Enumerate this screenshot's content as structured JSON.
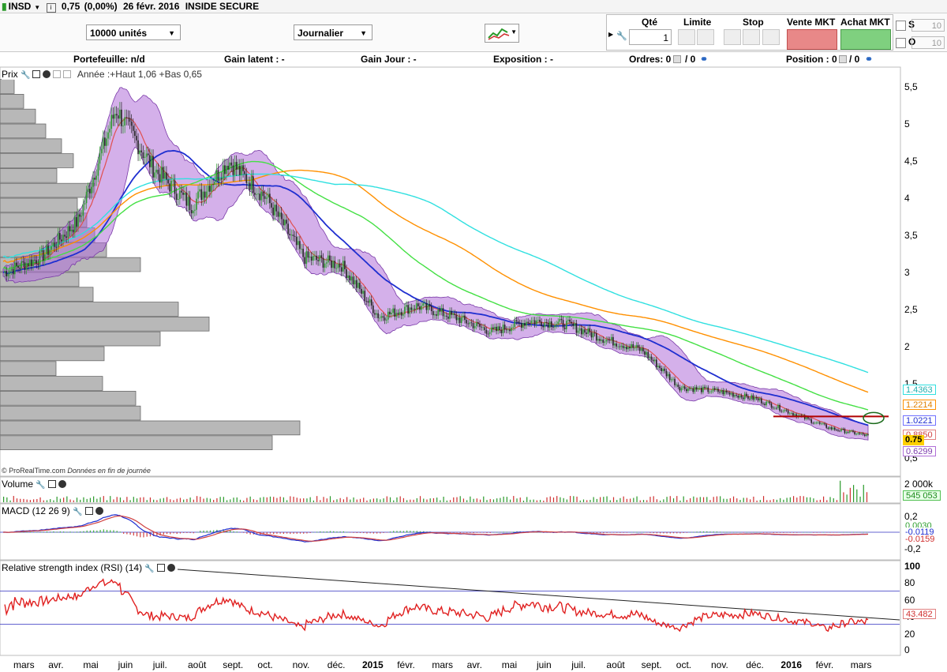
{
  "title_bar": {
    "ticker": "INSD",
    "price": "0,75",
    "change": "(0,00%)",
    "date": "26 févr. 2016",
    "name": "INSIDE SECURE"
  },
  "toolbar": {
    "quantity_select": "10000 unités",
    "period_select": "Journalier",
    "qty_header": "Qté",
    "limit_header": "Limite",
    "stop_header": "Stop",
    "sell_header": "Vente MKT",
    "buy_header": "Achat MKT",
    "qty_value": "1",
    "s_label": "S",
    "o_label": "O",
    "s_value": "10",
    "o_value": "10"
  },
  "status": {
    "portfolio": "Portefeuille: n/d",
    "latent": "Gain latent : -",
    "day": "Gain Jour : -",
    "exposure": "Exposition : -",
    "orders": "Ordres: 0",
    "orders2": "/ 0",
    "position": "Position : 0",
    "position2": "/ 0"
  },
  "price_panel": {
    "label": "Prix",
    "annotation": "Année :+Haut 1,06 +Bas 0,65",
    "source": "© ProRealTime.com",
    "source2": "Données en fin de journée",
    "y_ticks": [
      "5,5",
      "5",
      "4,5",
      "4",
      "3,5",
      "3",
      "2,5",
      "2",
      "1,5",
      "1",
      "0,5"
    ],
    "badges": {
      "cyan": "1.4363",
      "orange": "1.2214",
      "green": "1.0221",
      "red": "0.8850",
      "price": "0.75",
      "purple": "0.6299"
    },
    "colors": {
      "band": "#b06fd8",
      "ma_blue": "#1f2fd0",
      "ma_red": "#e05050",
      "ma_green": "#44e044",
      "ma_orange": "#ff9000",
      "ma_cyan": "#30e0e0",
      "candle_up": "#2a9a2a",
      "candle_down": "#222222",
      "hline": "#b00000"
    }
  },
  "volume_panel": {
    "label": "Volume",
    "y_ticks": [
      "2 000k"
    ],
    "badge": "545 053"
  },
  "macd_panel": {
    "label": "MACD (12 26 9)",
    "y_ticks": [
      "0,2",
      "0",
      "-0,2"
    ],
    "badge1": "0.0030",
    "badge2": "-0.0119",
    "badge3": "-0.0159"
  },
  "rsi_panel": {
    "label": "Relative strength index (RSI) (14)",
    "y_ticks": [
      "100",
      "80",
      "60",
      "40",
      "20",
      "0"
    ],
    "badge": "43.482"
  },
  "x_axis": [
    {
      "label": "mars",
      "bold": false
    },
    {
      "label": "avr.",
      "bold": false
    },
    {
      "label": "mai",
      "bold": false
    },
    {
      "label": "juin",
      "bold": false
    },
    {
      "label": "juil.",
      "bold": false
    },
    {
      "label": "août",
      "bold": false
    },
    {
      "label": "sept.",
      "bold": false
    },
    {
      "label": "oct.",
      "bold": false
    },
    {
      "label": "nov.",
      "bold": false
    },
    {
      "label": "déc.",
      "bold": false
    },
    {
      "label": "2015",
      "bold": true
    },
    {
      "label": "févr.",
      "bold": false
    },
    {
      "label": "mars",
      "bold": false
    },
    {
      "label": "avr.",
      "bold": false
    },
    {
      "label": "mai",
      "bold": false
    },
    {
      "label": "juin",
      "bold": false
    },
    {
      "label": "juil.",
      "bold": false
    },
    {
      "label": "août",
      "bold": false
    },
    {
      "label": "sept.",
      "bold": false
    },
    {
      "label": "oct.",
      "bold": false
    },
    {
      "label": "nov.",
      "bold": false
    },
    {
      "label": "déc.",
      "bold": false
    },
    {
      "label": "2016",
      "bold": true
    },
    {
      "label": "févr.",
      "bold": false
    },
    {
      "label": "mars",
      "bold": false
    }
  ],
  "chart_data": {
    "type": "line",
    "title": "INSD 0,75 (0,00%) 26 févr. 2016 INSIDE SECURE",
    "x": [
      "mars",
      "avr.",
      "mai",
      "juin",
      "juil.",
      "août",
      "sept.",
      "oct.",
      "nov.",
      "déc.",
      "2015",
      "févr.",
      "mars",
      "avr.",
      "mai",
      "juin",
      "juil.",
      "août",
      "sept.",
      "oct.",
      "nov.",
      "déc.",
      "2016",
      "févr."
    ],
    "series": [
      {
        "name": "Prix",
        "values": [
          3.0,
          3.2,
          3.7,
          5.2,
          4.4,
          3.9,
          4.5,
          4.0,
          3.2,
          3.1,
          2.4,
          2.55,
          2.4,
          2.2,
          2.35,
          2.3,
          2.1,
          1.95,
          1.45,
          1.4,
          1.3,
          1.1,
          0.9,
          0.8
        ]
      }
    ],
    "hline": 1.06,
    "volume_by_price": [
      {
        "price": 5.5,
        "volume": 18
      },
      {
        "price": 5.3,
        "volume": 30
      },
      {
        "price": 5.1,
        "volume": 45
      },
      {
        "price": 4.9,
        "volume": 58
      },
      {
        "price": 4.7,
        "volume": 78
      },
      {
        "price": 4.5,
        "volume": 93
      },
      {
        "price": 4.3,
        "volume": 72
      },
      {
        "price": 4.1,
        "volume": 120
      },
      {
        "price": 3.9,
        "volume": 98
      },
      {
        "price": 3.7,
        "volume": 110
      },
      {
        "price": 3.5,
        "volume": 120
      },
      {
        "price": 3.3,
        "volume": 135
      },
      {
        "price": 3.1,
        "volume": 178
      },
      {
        "price": 2.9,
        "volume": 100
      },
      {
        "price": 2.7,
        "volume": 118
      },
      {
        "price": 2.5,
        "volume": 226
      },
      {
        "price": 2.3,
        "volume": 265
      },
      {
        "price": 2.1,
        "volume": 203
      },
      {
        "price": 1.9,
        "volume": 132
      },
      {
        "price": 1.7,
        "volume": 71
      },
      {
        "price": 1.5,
        "volume": 130
      },
      {
        "price": 1.3,
        "volume": 172
      },
      {
        "price": 1.1,
        "volume": 178
      },
      {
        "price": 0.9,
        "volume": 380
      },
      {
        "price": 0.7,
        "volume": 345
      }
    ],
    "ylim": [
      0.5,
      5.6
    ]
  }
}
